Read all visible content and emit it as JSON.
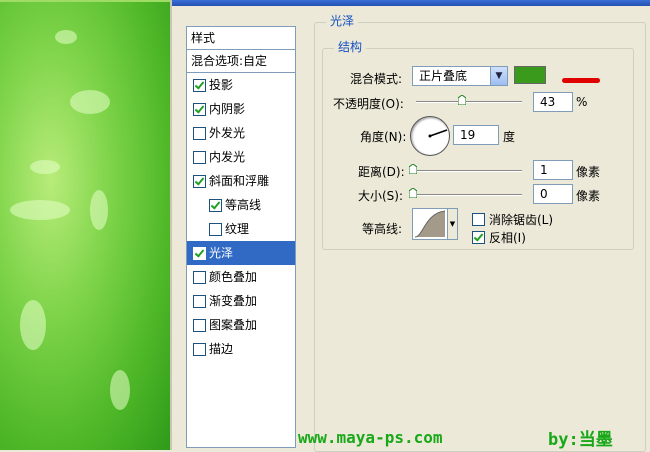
{
  "styles_panel": {
    "header": "样式",
    "blend_options": "混合选项:自定",
    "items": [
      {
        "label": "投影",
        "checked": true,
        "sub": false,
        "selected": false
      },
      {
        "label": "内阴影",
        "checked": true,
        "sub": false,
        "selected": false
      },
      {
        "label": "外发光",
        "checked": false,
        "sub": false,
        "selected": false
      },
      {
        "label": "内发光",
        "checked": false,
        "sub": false,
        "selected": false
      },
      {
        "label": "斜面和浮雕",
        "checked": true,
        "sub": false,
        "selected": false
      },
      {
        "label": "等高线",
        "checked": true,
        "sub": true,
        "selected": false
      },
      {
        "label": "纹理",
        "checked": false,
        "sub": true,
        "selected": false
      },
      {
        "label": "光泽",
        "checked": true,
        "sub": false,
        "selected": true
      },
      {
        "label": "颜色叠加",
        "checked": false,
        "sub": false,
        "selected": false
      },
      {
        "label": "渐变叠加",
        "checked": false,
        "sub": false,
        "selected": false
      },
      {
        "label": "图案叠加",
        "checked": false,
        "sub": false,
        "selected": false
      },
      {
        "label": "描边",
        "checked": false,
        "sub": false,
        "selected": false
      }
    ]
  },
  "gloss": {
    "title": "光泽",
    "structure_title": "结构",
    "blend_mode_label": "混合模式:",
    "blend_mode_value": "正片叠底",
    "color": "#3a9a1c",
    "opacity_label": "不透明度(O):",
    "opacity_value": "43",
    "opacity_unit": "%",
    "opacity_level": 0.43,
    "angle_label": "角度(N):",
    "angle_value": "19",
    "angle_unit": "度",
    "distance_label": "距离(D):",
    "distance_value": "1",
    "distance_unit": "像素",
    "size_label": "大小(S):",
    "size_value": "0",
    "size_unit": "像素",
    "contour_label": "等高线:",
    "antialias_label": "消除锯齿(L)",
    "antialias_checked": false,
    "invert_label": "反相(I)",
    "invert_checked": true
  },
  "watermark": {
    "site": "www.maya-ps.com",
    "author": "by:当墨"
  },
  "colors": {
    "selection": "#316ac5",
    "accent_text": "#1550c0",
    "watermark": "#18a818",
    "annotation": "#e00000"
  }
}
